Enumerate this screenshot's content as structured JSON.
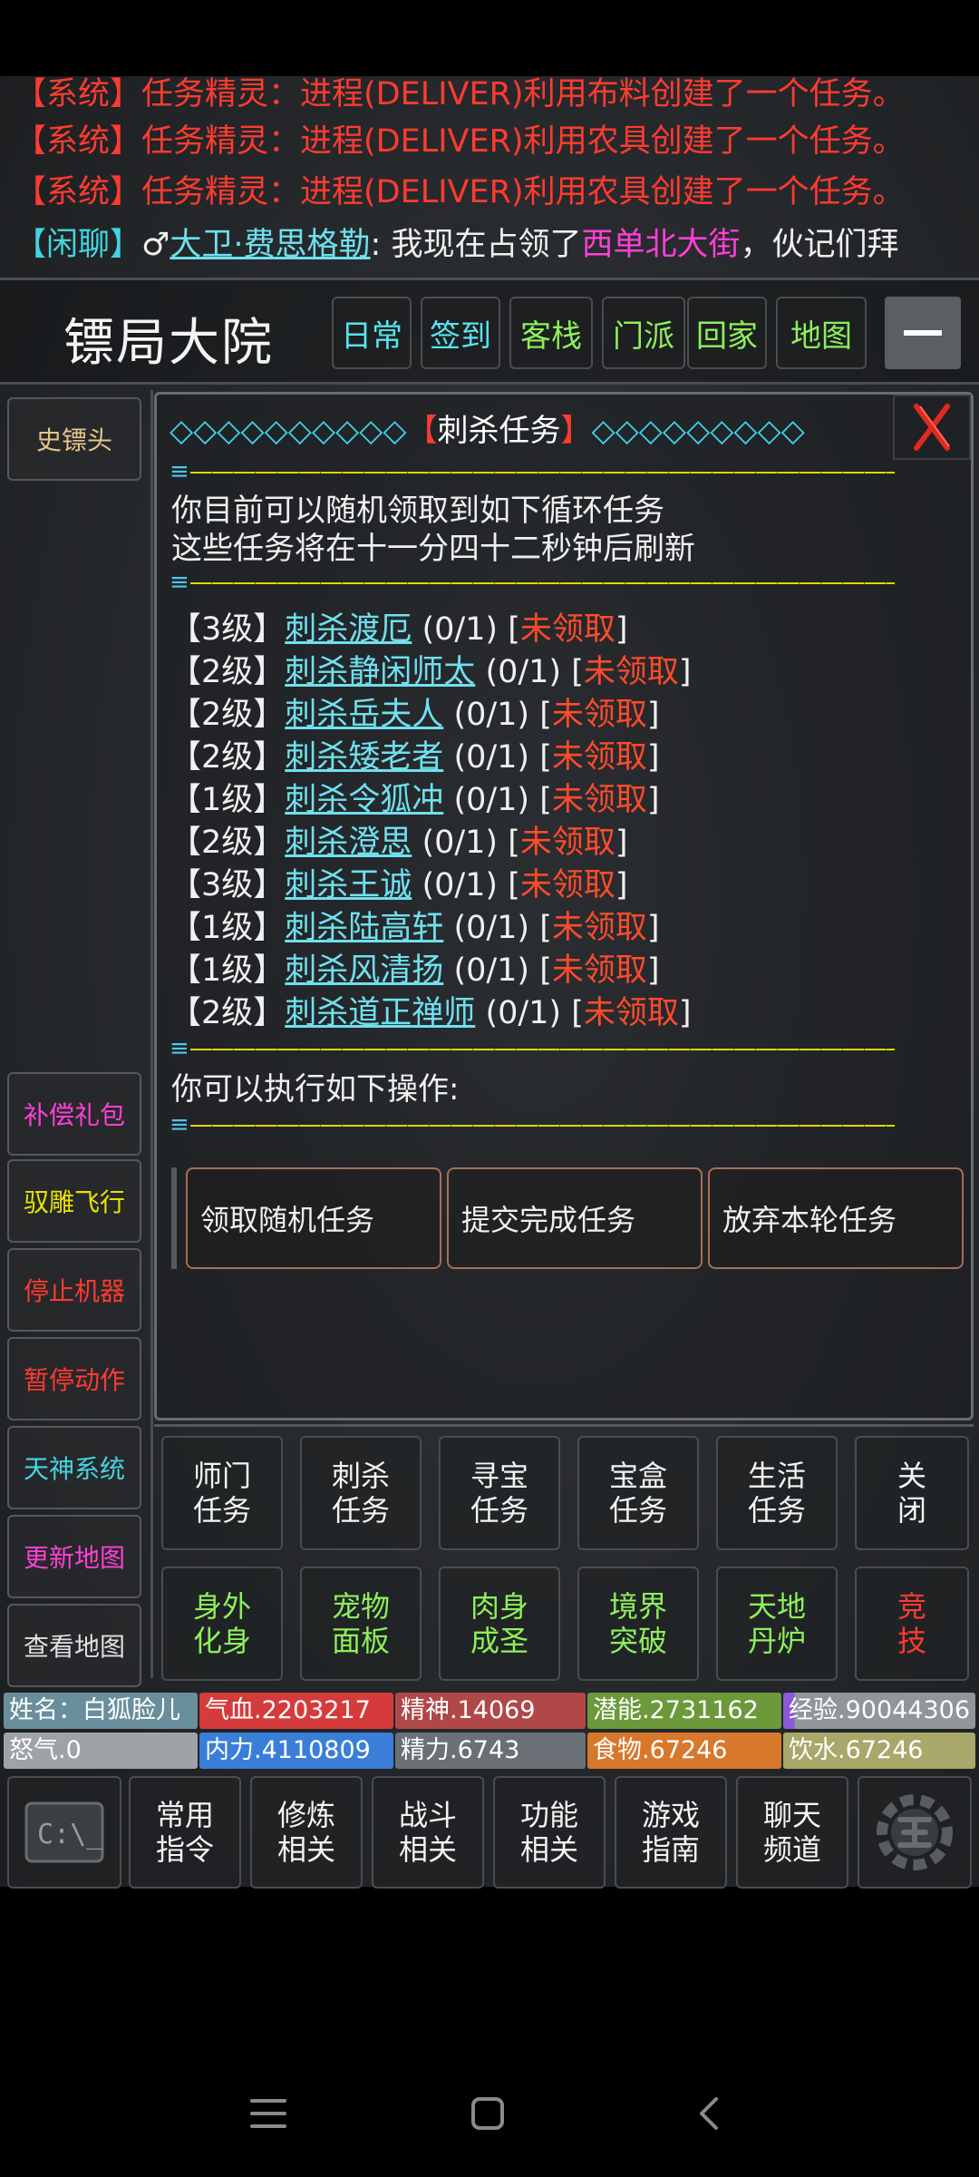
{
  "chat": {
    "lines": [
      {
        "tag": "【系统】",
        "text": "任务精灵：进程(DELIVER)利用布料创建了一个任务。"
      },
      {
        "tag": "【系统】",
        "text": "任务精灵：进程(DELIVER)利用农具创建了一个任务。"
      },
      {
        "tag": "【系统】",
        "text": "任务精灵：进程(DELIVER)利用农具创建了一个任务。"
      }
    ],
    "idle": {
      "tag": "【闲聊】",
      "gender_icon": "♂",
      "user": "大卫·费思格勒",
      "text1": ": 我现在占领了",
      "place": "西单北大街",
      "text2": "，伙记们拜"
    }
  },
  "header": {
    "title": "镖局大院",
    "buttons": [
      "日常",
      "签到",
      "客栈",
      "门派",
      "回家",
      "地图"
    ],
    "minimize_icon": "minus-icon"
  },
  "left_menu": {
    "top": "史镖头",
    "items": [
      "补偿礼包",
      "驭雕飞行",
      "停止机器",
      "暂停动作",
      "天神系统",
      "更新地图",
      "查看地图"
    ]
  },
  "dialog": {
    "diamonds_left": "◇◇◇◇◇◇◇◇◇◇",
    "bracket_open": "【",
    "title": "刺杀任务",
    "bracket_close": "】",
    "diamonds_right": "◇◇◇◇◇◇◇◇◇",
    "close_icon": "close-x-icon",
    "sep_end": "≡",
    "sep_dash": "——————————————————————————————————",
    "intro_line1": "你目前可以随机领取到如下循环任务",
    "intro_line2": "这些任务将在十一分四十二秒钟后刷新",
    "tasks": [
      {
        "level": "【3级】",
        "name": "刺杀渡厄",
        "progress": "(0/1)",
        "status": "未领取"
      },
      {
        "level": "【2级】",
        "name": "刺杀静闲师太",
        "progress": "(0/1)",
        "status": "未领取"
      },
      {
        "level": "【2级】",
        "name": "刺杀岳夫人",
        "progress": "(0/1)",
        "status": "未领取"
      },
      {
        "level": "【2级】",
        "name": "刺杀矮老者",
        "progress": "(0/1)",
        "status": "未领取"
      },
      {
        "level": "【1级】",
        "name": "刺杀令狐冲",
        "progress": "(0/1)",
        "status": "未领取"
      },
      {
        "level": "【2级】",
        "name": "刺杀澄思",
        "progress": "(0/1)",
        "status": "未领取"
      },
      {
        "level": "【3级】",
        "name": "刺杀王诚",
        "progress": "(0/1)",
        "status": "未领取"
      },
      {
        "level": "【1级】",
        "name": "刺杀陆高轩",
        "progress": "(0/1)",
        "status": "未领取"
      },
      {
        "level": "【1级】",
        "name": "刺杀风清扬",
        "progress": "(0/1)",
        "status": "未领取"
      },
      {
        "level": "【2级】",
        "name": "刺杀道正禅师",
        "progress": "(0/1)",
        "status": "未领取"
      }
    ],
    "ops_label": "你可以执行如下操作:",
    "actions": [
      "领取随机任务",
      "提交完成任务",
      "放弃本轮任务"
    ]
  },
  "task_menu": {
    "row1": [
      "师门\n任务",
      "刺杀\n任务",
      "寻宝\n任务",
      "宝盒\n任务",
      "生活\n任务",
      "关\n闭"
    ],
    "row2": [
      "身外\n化身",
      "宠物\n面板",
      "肉身\n成圣",
      "境界\n突破",
      "天地\n丹炉",
      "竞\n技"
    ]
  },
  "stats": {
    "name": "姓名：白狐脸儿",
    "hp": "气血.2203217",
    "spirit": "精神.14069",
    "potential": "潜能.2731162",
    "exp": "经验.90044306",
    "rage": "怒气.0",
    "neili": "内力.4110809",
    "energy": "精力.6743",
    "food": "食物.67246",
    "water": "饮水.67246"
  },
  "bottom_bar": {
    "console_icon": "console-icon",
    "buttons": [
      "常用\n指令",
      "修炼\n相关",
      "战斗\n相关",
      "功能\n相关",
      "游戏\n指南",
      "聊天\n频道"
    ],
    "main_icon": "main-gear-icon"
  },
  "colors": {
    "cyan": "#57e4ef",
    "green": "#8ef05a",
    "red": "#ff3b30",
    "magenta": "#ff3fd7",
    "yellow": "#e7e200"
  }
}
